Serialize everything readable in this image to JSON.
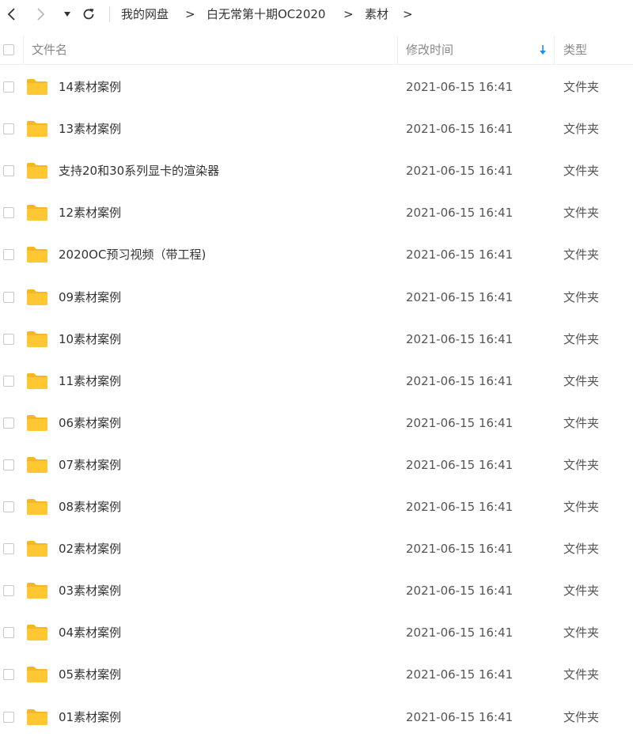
{
  "breadcrumb": [
    "我的网盘",
    "白无常第十期OC2020",
    "素材"
  ],
  "breadcrumb_separator": ">",
  "columns": {
    "name": "文件名",
    "modified": "修改时间",
    "type": "类型"
  },
  "sort": {
    "column": "modified",
    "direction": "descending"
  },
  "colors": {
    "folder": "#FFC832",
    "folder_back": "#F5B728",
    "accent": "#1E8FE8"
  },
  "files": [
    {
      "name": "14素材案例",
      "modified": "2021-06-15 16:41",
      "type": "文件夹"
    },
    {
      "name": "13素材案例",
      "modified": "2021-06-15 16:41",
      "type": "文件夹"
    },
    {
      "name": "支持20和30系列显卡的渲染器",
      "modified": "2021-06-15 16:41",
      "type": "文件夹"
    },
    {
      "name": "12素材案例",
      "modified": "2021-06-15 16:41",
      "type": "文件夹"
    },
    {
      "name": "2020OC预习视频（带工程)",
      "modified": "2021-06-15 16:41",
      "type": "文件夹"
    },
    {
      "name": "09素材案例",
      "modified": "2021-06-15 16:41",
      "type": "文件夹"
    },
    {
      "name": "10素材案例",
      "modified": "2021-06-15 16:41",
      "type": "文件夹"
    },
    {
      "name": "11素材案例",
      "modified": "2021-06-15 16:41",
      "type": "文件夹"
    },
    {
      "name": "06素材案例",
      "modified": "2021-06-15 16:41",
      "type": "文件夹"
    },
    {
      "name": "07素材案例",
      "modified": "2021-06-15 16:41",
      "type": "文件夹"
    },
    {
      "name": "08素材案例",
      "modified": "2021-06-15 16:41",
      "type": "文件夹"
    },
    {
      "name": "02素材案例",
      "modified": "2021-06-15 16:41",
      "type": "文件夹"
    },
    {
      "name": "03素材案例",
      "modified": "2021-06-15 16:41",
      "type": "文件夹"
    },
    {
      "name": "04素材案例",
      "modified": "2021-06-15 16:41",
      "type": "文件夹"
    },
    {
      "name": "05素材案例",
      "modified": "2021-06-15 16:41",
      "type": "文件夹"
    },
    {
      "name": "01素材案例",
      "modified": "2021-06-15 16:41",
      "type": "文件夹"
    }
  ]
}
